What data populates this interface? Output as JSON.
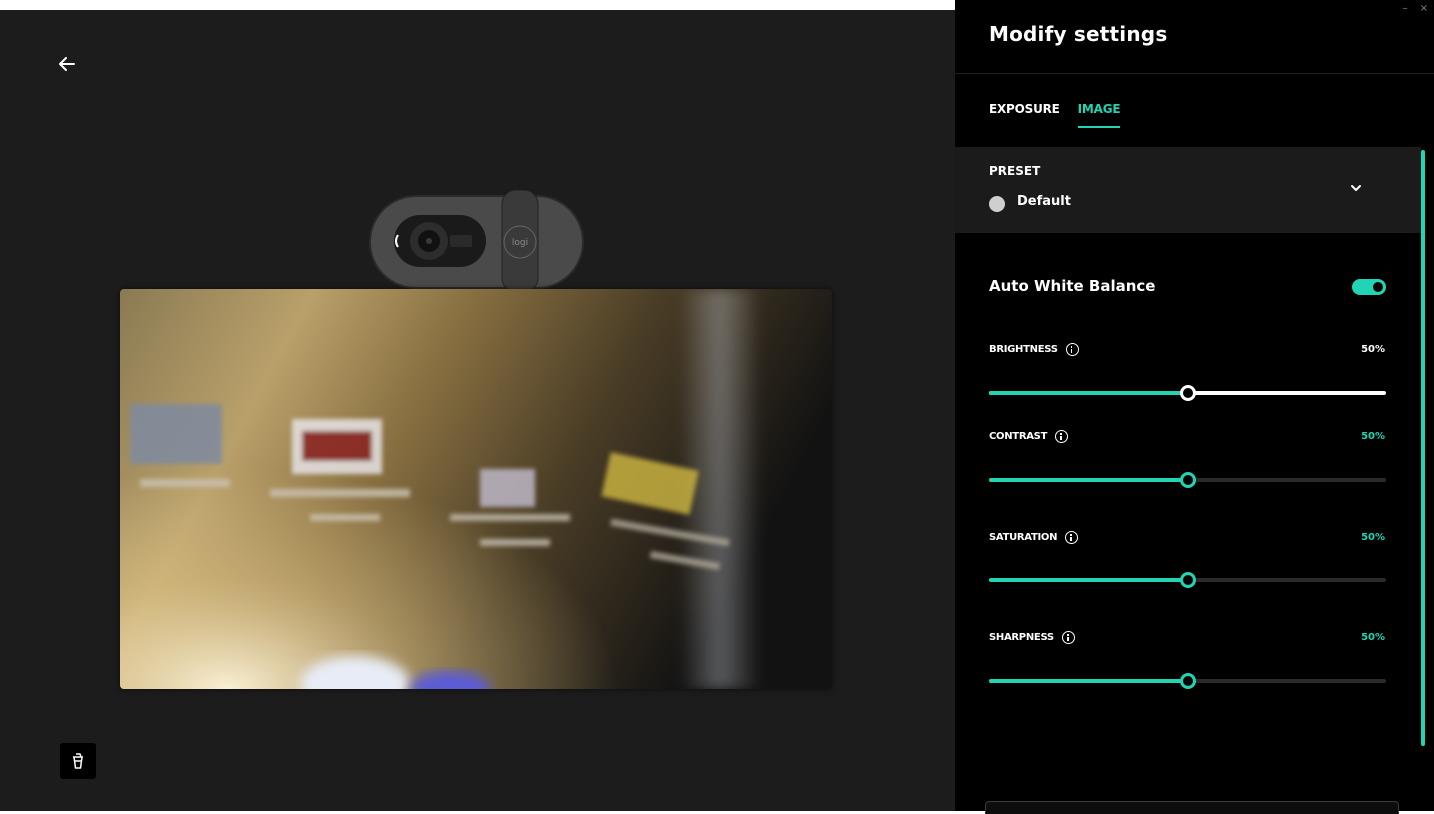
{
  "panel": {
    "title": "Modify settings",
    "window_controls": {
      "minimize": "–",
      "close": "×"
    },
    "tabs": [
      {
        "label": "EXPOSURE",
        "active": false
      },
      {
        "label": "IMAGE",
        "active": true
      }
    ],
    "preset": {
      "label": "PRESET",
      "value": "Default"
    },
    "auto_white_balance": {
      "label": "Auto White Balance",
      "enabled": true
    },
    "sliders": [
      {
        "label": "BRIGHTNESS",
        "value_text": "50%",
        "value": 0.5
      },
      {
        "label": "CONTRAST",
        "value_text": "50%",
        "value": 0.5
      },
      {
        "label": "SATURATION",
        "value_text": "50%",
        "value": 0.5
      },
      {
        "label": "SHARPNESS",
        "value_text": "50%",
        "value": 0.5
      }
    ]
  },
  "camera": {
    "brand": "logi"
  },
  "colors": {
    "accent": "#21d4b3",
    "panel_bg": "#000000",
    "stage_bg": "#1c1c1c"
  },
  "icons": {
    "back": "arrow-left-icon",
    "bottom_tool": "cup-icon",
    "info": "info-icon",
    "chevron": "chevron-down-icon"
  }
}
